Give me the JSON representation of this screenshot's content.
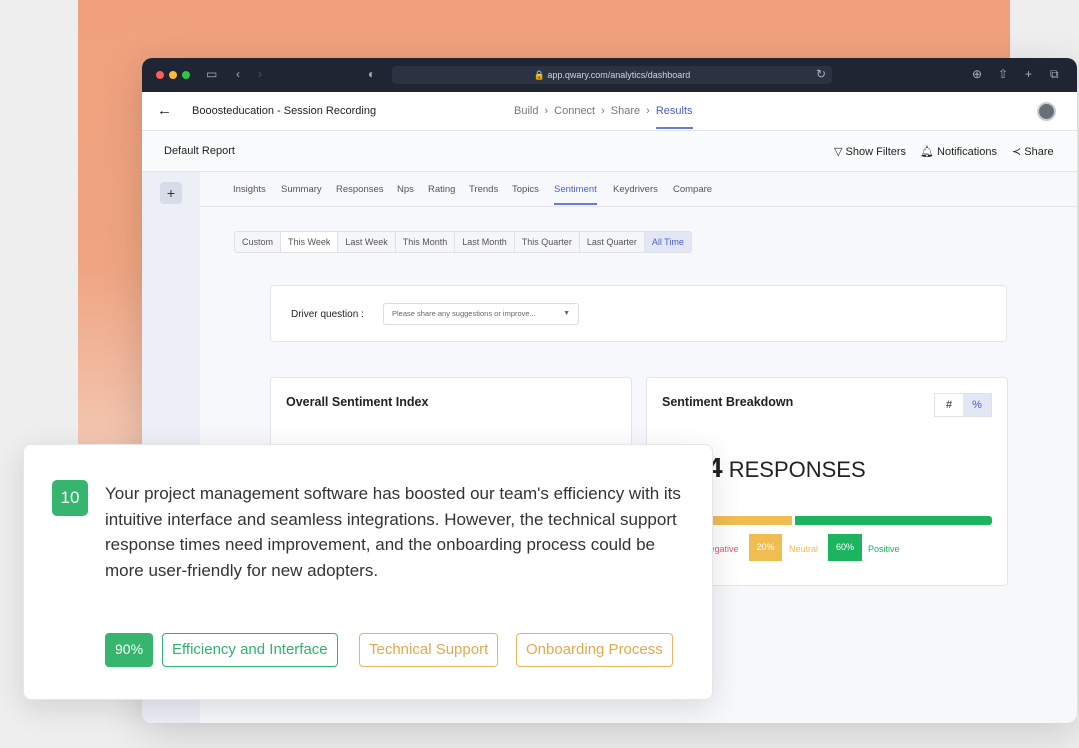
{
  "browser": {
    "url": "app.qwary.com/analytics/dashboard"
  },
  "header": {
    "title": "Booosteducation - Session Recording",
    "steps": [
      "Build",
      "Connect",
      "Share",
      "Results"
    ],
    "active_step": "Results"
  },
  "report": {
    "title": "Default Report",
    "actions": [
      "Show Filters",
      "Notifications",
      "Share"
    ]
  },
  "tabs": [
    "Insights",
    "Summary",
    "Responses",
    "Nps",
    "Rating",
    "Trends",
    "Topics",
    "Sentiment",
    "Keydrivers",
    "Compare"
  ],
  "active_tab": "Sentiment",
  "date_ranges": [
    "Custom",
    "This Week",
    "Last Week",
    "This Month",
    "Last Month",
    "This Quarter",
    "Last Quarter",
    "All Time"
  ],
  "active_date_range": "All Time",
  "driver": {
    "label": "Driver question :",
    "placeholder": "Please share any suggestions or improve..."
  },
  "overall": {
    "title": "Overall Sentiment Index"
  },
  "breakdown": {
    "title": "Sentiment Breakdown",
    "toggle": [
      "#",
      "%"
    ],
    "responses_count": "4",
    "responses_label": "RESPONSES",
    "segments": [
      {
        "label": "Negative",
        "shown": "gative",
        "color": "#e05a6a"
      },
      {
        "label": "Neutral",
        "value": "20%",
        "color": "#efbd52"
      },
      {
        "label": "Positive",
        "value": "60%",
        "color": "#1cb45f"
      }
    ],
    "positive_fraction": 0.6,
    "neutral_fraction": 0.2
  },
  "review": {
    "score": "10",
    "text": "Your project management software has boosted our team's efficiency with its intuitive interface and seamless integrations. However, the technical support response times need improvement, and the onboarding process could be more user-friendly for new adopters.",
    "percent": "90%",
    "tags": [
      {
        "label": "Efficiency and Interface",
        "color": "#2fb36e"
      },
      {
        "label": "Technical Support",
        "color": "#e9b463"
      },
      {
        "label": "Onboarding Process",
        "color": "#e9b463"
      }
    ]
  },
  "colors": {
    "accent": "#4b5fc4",
    "positive": "#1cb45f",
    "neutral": "#efbd52",
    "negative": "#e05a6a"
  }
}
